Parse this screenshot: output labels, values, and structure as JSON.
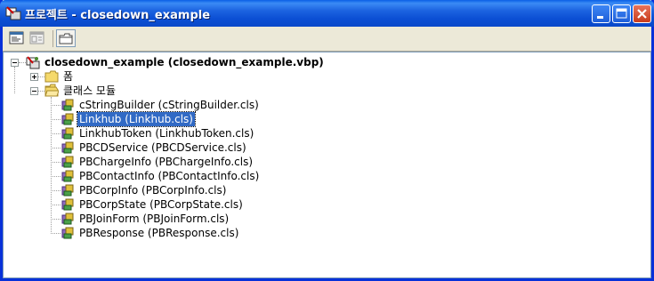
{
  "window": {
    "title": "프로젝트 - closedown_example"
  },
  "toolbar": {
    "view_code_icon": "view-code-icon",
    "view_object_icon": "view-object-icon",
    "toggle_folders_icon": "folder-icon"
  },
  "tree": {
    "root": {
      "label": "closedown_example (closedown_example.vbp)",
      "expanded": true
    },
    "forms_folder": {
      "label": "폼",
      "expanded": false
    },
    "classes_folder": {
      "label": "클래스 모듈",
      "expanded": true
    },
    "classes": [
      {
        "label": "cStringBuilder (cStringBuilder.cls)",
        "selected": false
      },
      {
        "label": "Linkhub (Linkhub.cls)",
        "selected": true
      },
      {
        "label": "LinkhubToken (LinkhubToken.cls)",
        "selected": false
      },
      {
        "label": "PBCDService (PBCDService.cls)",
        "selected": false
      },
      {
        "label": "PBChargeInfo (PBChargeInfo.cls)",
        "selected": false
      },
      {
        "label": "PBContactInfo (PBContactInfo.cls)",
        "selected": false
      },
      {
        "label": "PBCorpInfo (PBCorpInfo.cls)",
        "selected": false
      },
      {
        "label": "PBCorpState (PBCorpState.cls)",
        "selected": false
      },
      {
        "label": "PBJoinForm (PBJoinForm.cls)",
        "selected": false
      },
      {
        "label": "PBResponse (PBResponse.cls)",
        "selected": false
      }
    ]
  },
  "colors": {
    "title_bar": "#0a49c9",
    "selection": "#316ac5",
    "close_button": "#c83c1c",
    "window_bg": "#ece9d8"
  }
}
